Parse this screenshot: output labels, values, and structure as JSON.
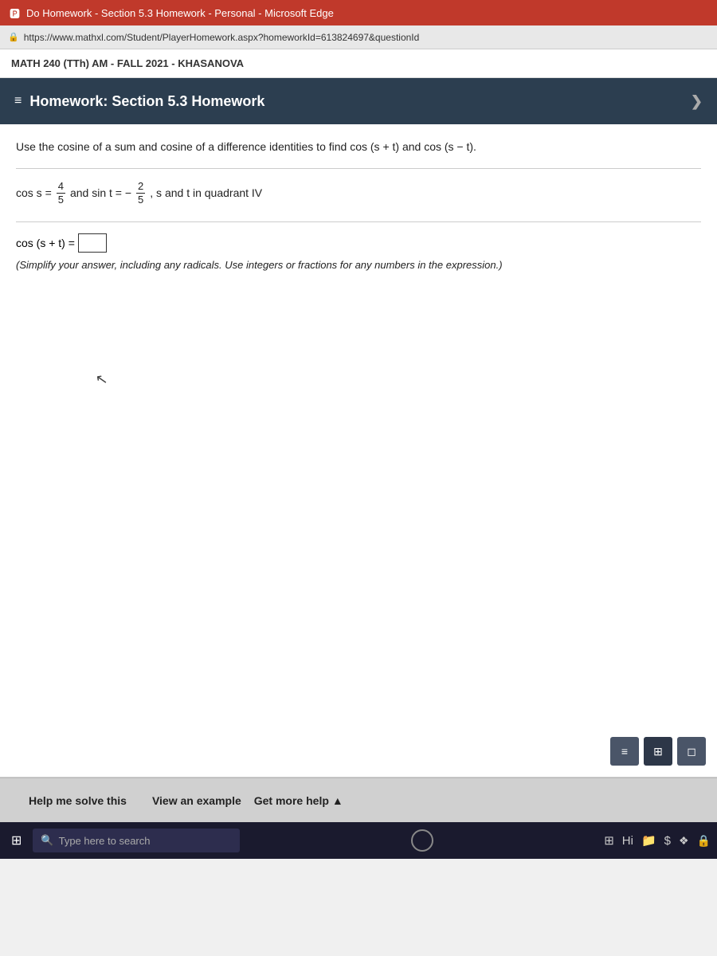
{
  "titlebar": {
    "text": "Do Homework - Section 5.3 Homework - Personal - Microsoft Edge",
    "icon": "🅿"
  },
  "addressbar": {
    "url": "https://www.mathxl.com/Student/PlayerHomework.aspx?homeworkId=613824697&questionId",
    "lock_icon": "🔒"
  },
  "course_header": {
    "text": "MATH 240 (TTh) AM - FALL 2021 - KHASANOVA"
  },
  "homework_header": {
    "prefix": "≡",
    "title": "Homework: Section 5.3 Homework",
    "chevron": "❯"
  },
  "problem": {
    "instruction": "Use the cosine of a sum and cosine of a difference identities to find cos (s + t) and cos (s − t).",
    "condition_prefix": "cos s =",
    "cos_s_num": "4",
    "cos_s_den": "5",
    "condition_middle": "and sin t = −",
    "sin_t_num": "2",
    "sin_t_den": "5",
    "condition_suffix": ", s and t in quadrant IV",
    "answer_label": "cos (s + t) =",
    "simplify_note": "(Simplify your answer, including any radicals. Use integers or fractions for any numbers in the expression.)"
  },
  "tool_buttons": [
    {
      "label": "≡",
      "name": "matrix-icon"
    },
    {
      "label": "⊞",
      "name": "grid-icon"
    },
    {
      "label": "◻",
      "name": "square-icon"
    }
  ],
  "help_bar": {
    "help_me_solve": "Help me solve this",
    "view_example": "View an example",
    "get_more_help": "Get more help",
    "chevron_up": "▲"
  },
  "taskbar": {
    "start_icon": "⊞",
    "search_placeholder": "Type here to search",
    "search_icon": "🔍",
    "circle_btn": "",
    "icons": [
      "⊞",
      "Hi",
      "📁",
      "$",
      "❖",
      "🔒"
    ]
  }
}
